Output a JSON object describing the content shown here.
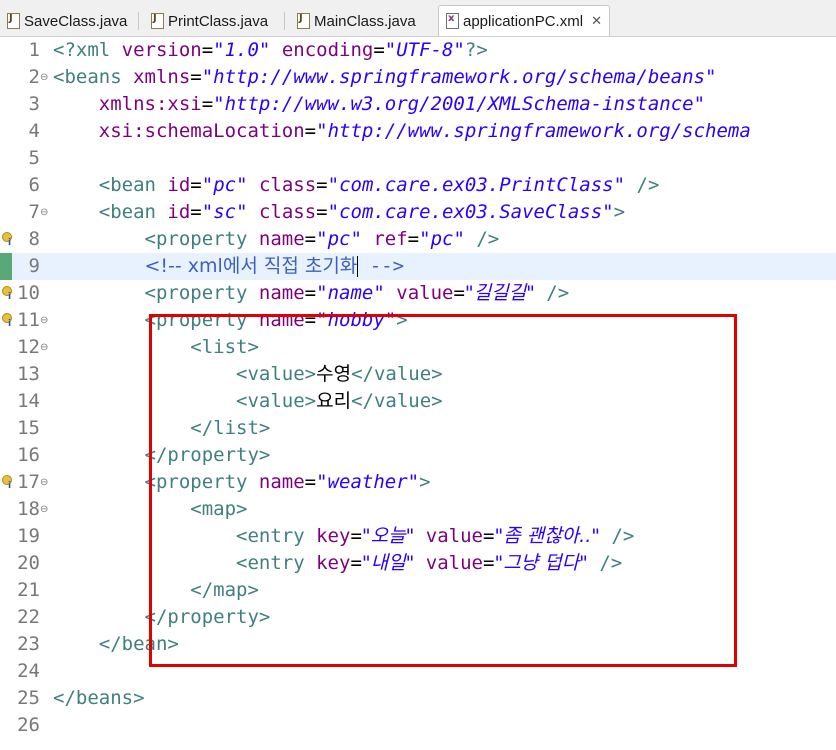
{
  "tabs": [
    {
      "label": "SaveClass.java",
      "icon": "java-file-icon",
      "active": false
    },
    {
      "label": "PrintClass.java",
      "icon": "java-file-icon",
      "active": false
    },
    {
      "label": "MainClass.java",
      "icon": "java-file-icon",
      "active": false
    },
    {
      "label": "applicationPC.xml",
      "icon": "xml-file-icon",
      "active": true,
      "close": "✕"
    }
  ],
  "editor": {
    "lines": [
      {
        "n": "1"
      },
      {
        "n": "2"
      },
      {
        "n": "3"
      },
      {
        "n": "4"
      },
      {
        "n": "5"
      },
      {
        "n": "6"
      },
      {
        "n": "7"
      },
      {
        "n": "8"
      },
      {
        "n": "9"
      },
      {
        "n": "10"
      },
      {
        "n": "11"
      },
      {
        "n": "12"
      },
      {
        "n": "13"
      },
      {
        "n": "14"
      },
      {
        "n": "15"
      },
      {
        "n": "16"
      },
      {
        "n": "17"
      },
      {
        "n": "18"
      },
      {
        "n": "19"
      },
      {
        "n": "20"
      },
      {
        "n": "21"
      },
      {
        "n": "22"
      },
      {
        "n": "23"
      },
      {
        "n": "24"
      },
      {
        "n": "25"
      },
      {
        "n": "26"
      }
    ],
    "xml_decl": {
      "version": "\"1.0\"",
      "encoding": "\"UTF-8\""
    },
    "beans_xmlns": "\"http://www.springframework.org/schema/beans\"",
    "beans_xsi": "\"http://www.w3.org/2001/XMLSchema-instance\"",
    "beans_schemaloc": "\"http://www.springframework.org/schema",
    "bean_pc": {
      "id": "\"pc\"",
      "class": "\"com.care.ex03.PrintClass\""
    },
    "bean_sc": {
      "id": "\"sc\"",
      "class": "\"com.care.ex03.SaveClass\""
    },
    "prop_pc": {
      "name": "\"pc\"",
      "ref": "\"pc\""
    },
    "comment": "<!-- xml에서 직접 초기화",
    "comment_end": " -->",
    "prop_name": {
      "name": "name",
      "value": "\"길길길\""
    },
    "prop_hobby": {
      "name": "hobby"
    },
    "list_values": [
      "수영",
      "요리"
    ],
    "prop_weather": {
      "name": "weather"
    },
    "entries": [
      {
        "key": "\"오늘\"",
        "value": "\"좀 괜찮아..\""
      },
      {
        "key": "\"내일\"",
        "value": "\"그냥 덥다\""
      }
    ]
  },
  "colors": {
    "highlight_box": "#e00000",
    "current_line": "#e8f2fe"
  }
}
